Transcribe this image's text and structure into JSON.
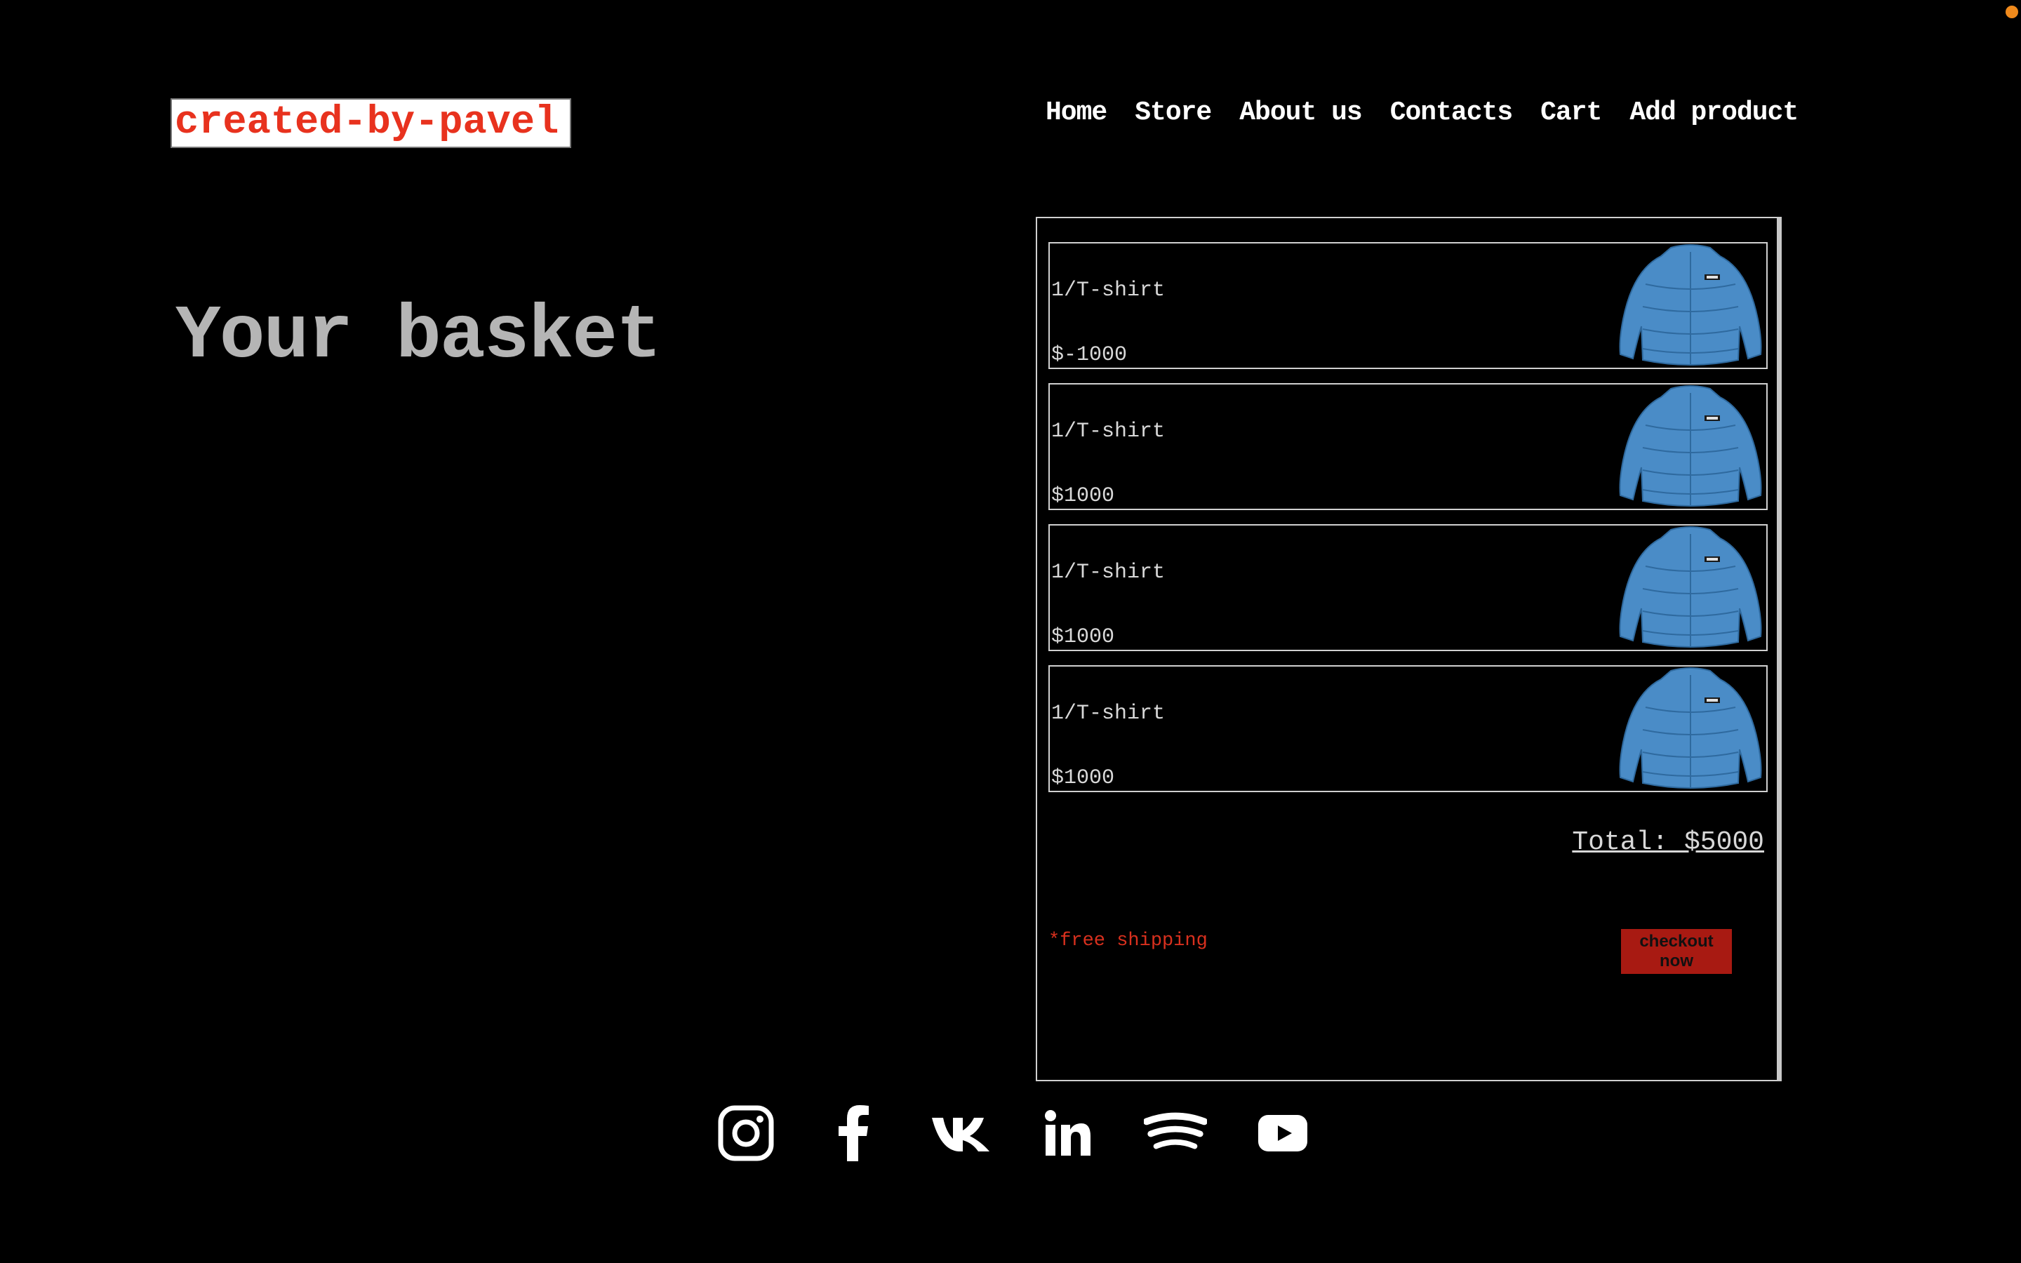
{
  "logo": {
    "text": "created-by-pavel"
  },
  "nav": {
    "items": [
      {
        "label": "Home"
      },
      {
        "label": "Store"
      },
      {
        "label": "About us"
      },
      {
        "label": "Contacts"
      },
      {
        "label": "Cart"
      },
      {
        "label": "Add product"
      }
    ]
  },
  "page": {
    "title": "Your basket"
  },
  "basket": {
    "items": [
      {
        "name": "1/T-shirt",
        "price": "$-1000",
        "thumbnail_icon": "blue-puffer-jacket"
      },
      {
        "name": "1/T-shirt",
        "price": "$1000",
        "thumbnail_icon": "blue-puffer-jacket"
      },
      {
        "name": "1/T-shirt",
        "price": "$1000",
        "thumbnail_icon": "blue-puffer-jacket"
      },
      {
        "name": "1/T-shirt",
        "price": "$1000",
        "thumbnail_icon": "blue-puffer-jacket"
      }
    ],
    "total": "Total: $5000",
    "shipping_note": "*free shipping",
    "checkout_label": "checkout now"
  },
  "socials": [
    {
      "icon": "instagram-icon"
    },
    {
      "icon": "facebook-icon"
    },
    {
      "icon": "vk-icon"
    },
    {
      "icon": "linkedin-icon"
    },
    {
      "icon": "spotify-icon"
    },
    {
      "icon": "youtube-icon"
    }
  ],
  "colors": {
    "background": "#000000",
    "accent_red": "#e8321e",
    "checkout_button": "#a81a12",
    "muted_text": "#b5b5b5",
    "jacket_blue": "#4a8cc7"
  }
}
